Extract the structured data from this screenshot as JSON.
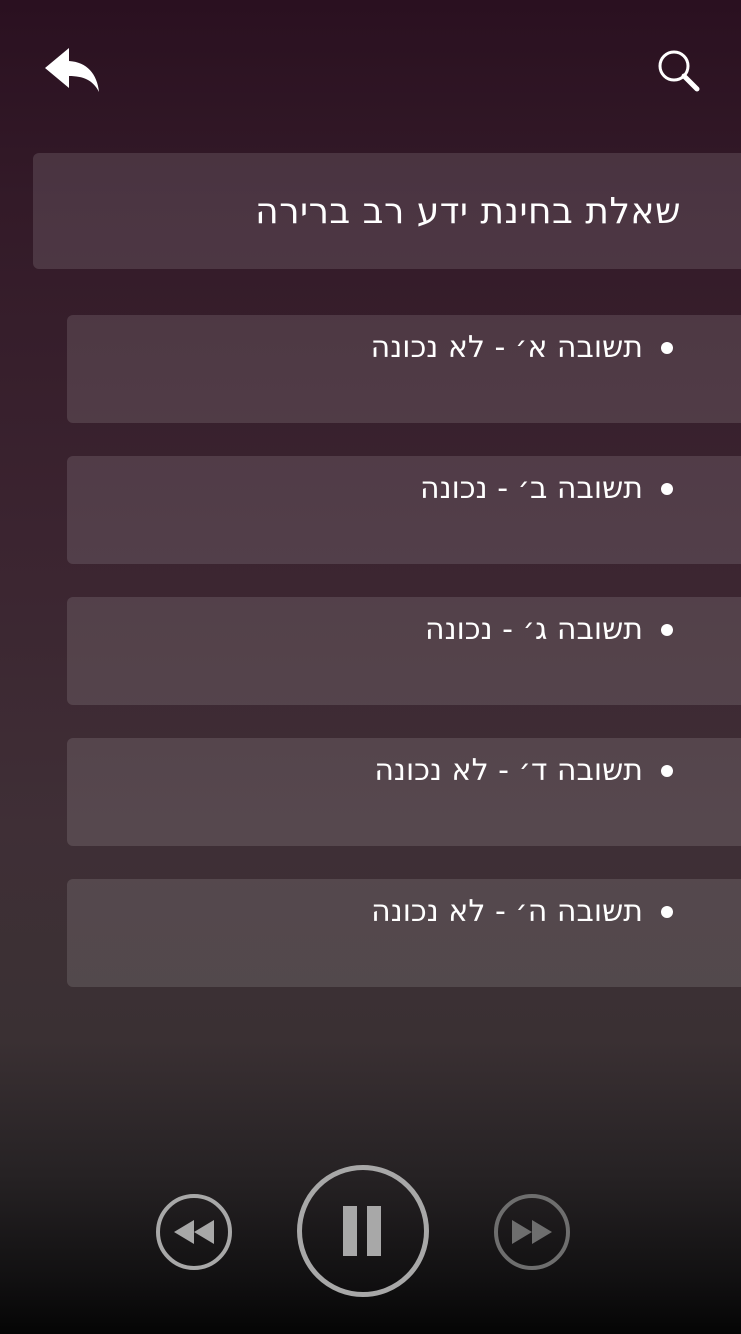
{
  "header": {
    "back_icon": "reply-arrow-icon",
    "search_icon": "search-icon"
  },
  "question": {
    "text": "שאלת בחינת ידע רב ברירה"
  },
  "answers": [
    {
      "label": "תשובה א׳ - לא נכונה"
    },
    {
      "label": "תשובה ב׳ - נכונה"
    },
    {
      "label": "תשובה ג׳ - נכונה"
    },
    {
      "label": "תשובה ד׳ - לא נכונה"
    },
    {
      "label": "תשובה ה׳ - לא נכונה"
    }
  ],
  "player": {
    "rewind_icon": "rewind-icon",
    "pause_icon": "pause-icon",
    "forward_icon": "fast-forward-icon",
    "colors": {
      "active": "#a8a8a8",
      "disabled": "#6e6e6e"
    }
  }
}
